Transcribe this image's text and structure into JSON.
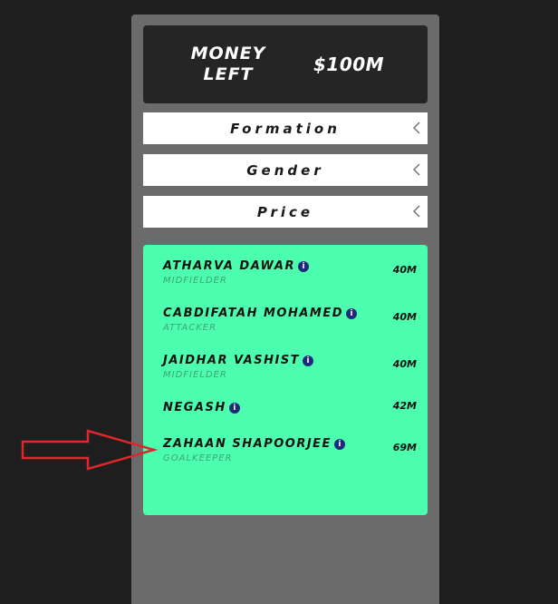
{
  "budget": {
    "label": "MONEY LEFT",
    "value": "$100M"
  },
  "filters": [
    {
      "label": "Formation",
      "icon": "chevron-left-icon"
    },
    {
      "label": "Gender",
      "icon": "chevron-left-icon"
    },
    {
      "label": "Price",
      "icon": "chevron-left-icon"
    }
  ],
  "players": [
    {
      "name": "ATHARVA DAWAR",
      "position": "MIDFIELDER",
      "price": "40M"
    },
    {
      "name": "CABDIFATAH MOHAMED",
      "position": "ATTACKER",
      "price": "40M"
    },
    {
      "name": "JAIDHAR VASHIST",
      "position": "MIDFIELDER",
      "price": "40M"
    },
    {
      "name": "NEGASH",
      "position": "",
      "price": "42M"
    },
    {
      "name": "ZAHAAN SHAPOORJEE",
      "position": "GOALKEEPER",
      "price": "69M"
    }
  ],
  "info_glyph": "i",
  "colors": {
    "background": "#1e1e1e",
    "panel": "#6b6b6b",
    "money_box": "#252525",
    "list_box": "#4cffae",
    "info_icon": "#1f2b7a",
    "annotation_arrow": "#e0262b"
  }
}
